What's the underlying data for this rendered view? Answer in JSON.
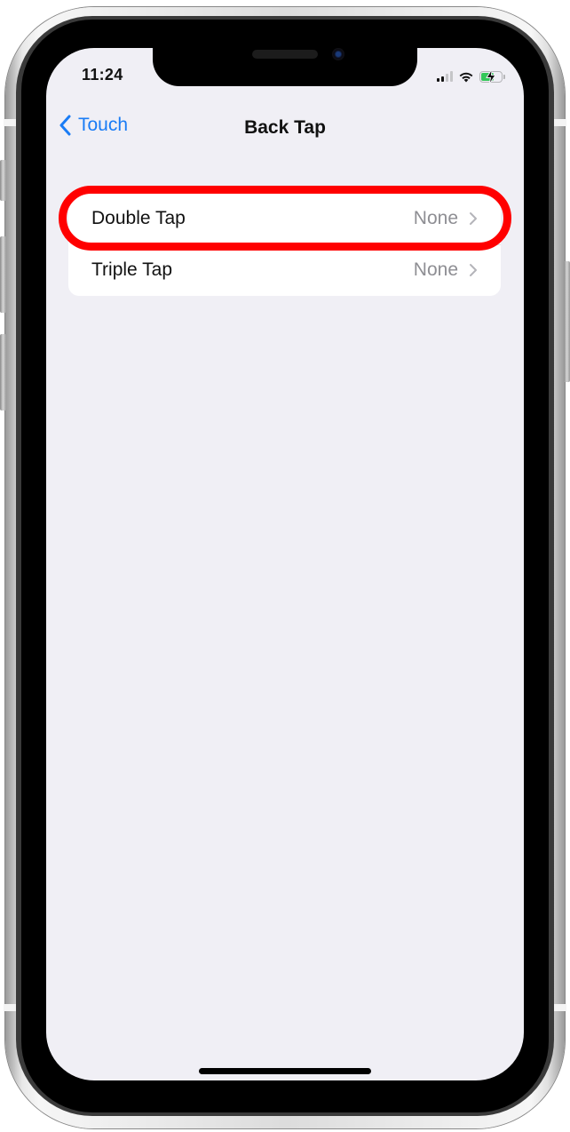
{
  "status_bar": {
    "time": "11:24",
    "signal_bars_active": 2,
    "signal_bars_total": 4,
    "wifi": "wifi-icon",
    "battery_state": "charging",
    "battery_color": "#34c759"
  },
  "nav": {
    "back_label": "Touch",
    "title": "Back Tap",
    "accent_color": "#1a7cf5"
  },
  "settings": {
    "rows": [
      {
        "label": "Double Tap",
        "value": "None",
        "highlighted": true
      },
      {
        "label": "Triple Tap",
        "value": "None",
        "highlighted": false
      }
    ]
  },
  "annotation": {
    "color": "#ff0000",
    "target": "Double Tap"
  }
}
